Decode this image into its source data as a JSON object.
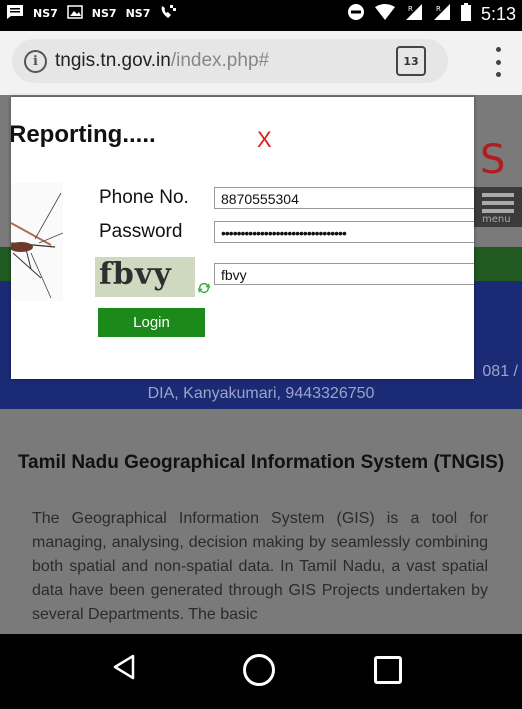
{
  "status_bar": {
    "carrier_1": "NS7",
    "carrier_2": "NS7",
    "carrier_3": "NS7",
    "time": "5:13",
    "icons": [
      "message-icon",
      "image-icon",
      "phone-icon",
      "do-not-disturb-icon",
      "wifi-icon",
      "signal-icon",
      "signal-icon",
      "battery-icon"
    ]
  },
  "browser": {
    "url_domain": "tngis.tn.gov.in",
    "url_path": "/index.php#",
    "tab_count": "13"
  },
  "page": {
    "menu_label": "menu",
    "contact_line": "DIA, Kanyakumari, 9443326750",
    "contact_partial": "081 /",
    "section_title": "Tamil Nadu Geographical Information System (TNGIS)",
    "body_text": "The Geographical Information System (GIS) is a tool for managing, analysing, decision making by seamlessly combining both spatial and non-spatial data. In Tamil Nadu, a vast spatial data have been generated through GIS Projects undertaken by several Departments. The basic"
  },
  "modal": {
    "title": "Reporting.....",
    "close_label": "X",
    "phone_label": "Phone No.",
    "phone_value": "8870555304",
    "password_label": "Password",
    "password_value": "••••••••••••••••••••••••••••••••",
    "captcha_text": "fbvy",
    "captcha_value": "fbvy",
    "login_label": "Login"
  },
  "colors": {
    "accent_green": "#1b8a1b",
    "close_red": "#e01b1b",
    "header_blue": "#1b2a75"
  }
}
